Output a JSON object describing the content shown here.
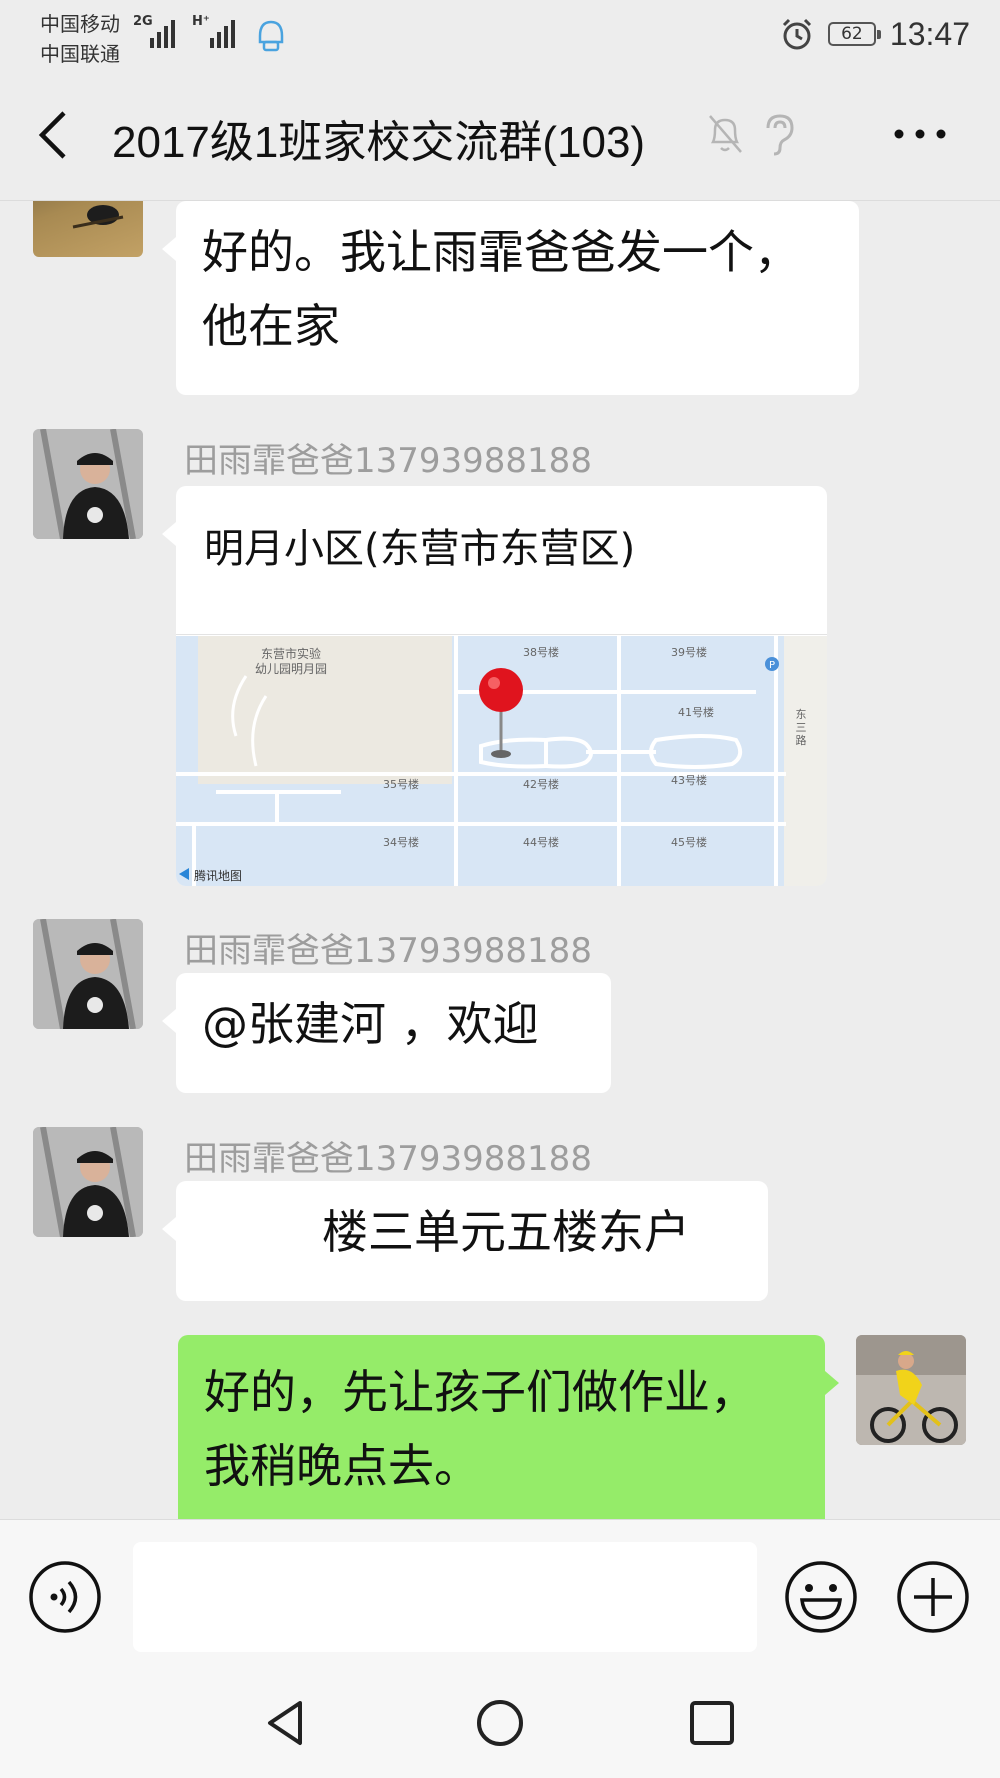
{
  "status_bar": {
    "carrier1": "中国移动",
    "carrier2": "中国联通",
    "net1": "2G",
    "net2": "H⁺",
    "battery": "62",
    "time": "13:47",
    "icons": [
      "signal-icon",
      "notification-icon",
      "alarm-icon",
      "battery-icon"
    ]
  },
  "header": {
    "title": "2017级1班家校交流群(103)",
    "icons": [
      "back-icon",
      "mute-icon",
      "ear-icon",
      "more-icon"
    ]
  },
  "messages": {
    "m1": {
      "text1": "好的。我让雨霏爸爸发一个，",
      "text2": "他在家"
    },
    "m2": {
      "sender": "田雨霏爸爸13793988188",
      "location_title": "明月小区(东营市东营区)",
      "map_labels": {
        "school1": "东营市实验",
        "school2": "幼儿园明月园",
        "b38": "38号楼",
        "b39": "39号楼",
        "b41": "41号楼",
        "b35": "35号楼",
        "b42": "42号楼",
        "b43": "43号楼",
        "b34": "34号楼",
        "b44": "44号楼",
        "b45": "45号楼",
        "road1": "东",
        "road2": "三",
        "road3": "路",
        "parking": "P",
        "provider": "腾讯地图"
      }
    },
    "m3": {
      "sender": "田雨霏爸爸13793988188",
      "text": "@张建河 ，欢迎"
    },
    "m4": {
      "sender": "田雨霏爸爸13793988188",
      "text": "楼三单元五楼东户"
    },
    "m5": {
      "text1": "好的，先让孩子们做作业，",
      "text2": "我稍晚点去。"
    }
  },
  "input_bar": {
    "placeholder": "",
    "icons": [
      "voice-icon",
      "emoji-icon",
      "plus-icon"
    ]
  },
  "nav_bar": {
    "icons": [
      "back-triangle-icon",
      "home-circle-icon",
      "recents-square-icon"
    ]
  },
  "colors": {
    "background": "#ededed",
    "my_bubble": "#95ec69",
    "other_bubble": "#ffffff",
    "map_water": "#d8e6f5"
  }
}
